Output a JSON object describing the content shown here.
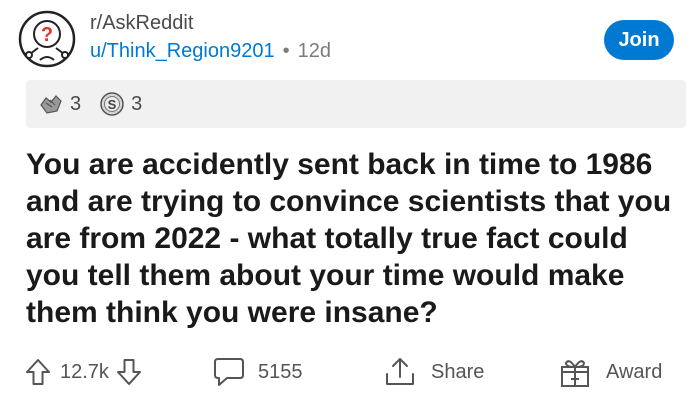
{
  "header": {
    "subreddit": "r/AskReddit",
    "author": "u/Think_Region9201",
    "separator": "•",
    "age": "12d",
    "join_label": "Join"
  },
  "awards": {
    "items": [
      {
        "icon": "award-hands-icon",
        "count": "3"
      },
      {
        "icon": "silver-award-icon",
        "count": "3"
      }
    ]
  },
  "post": {
    "title": "You are accidently sent back in time to 1986 and are trying to convince scientists that you are from 2022 - what totally true fact could you tell them about your time would make them think you were insane?"
  },
  "actions": {
    "upvotes": "12.7k",
    "comments": "5155",
    "share_label": "Share",
    "award_label": "Award"
  }
}
